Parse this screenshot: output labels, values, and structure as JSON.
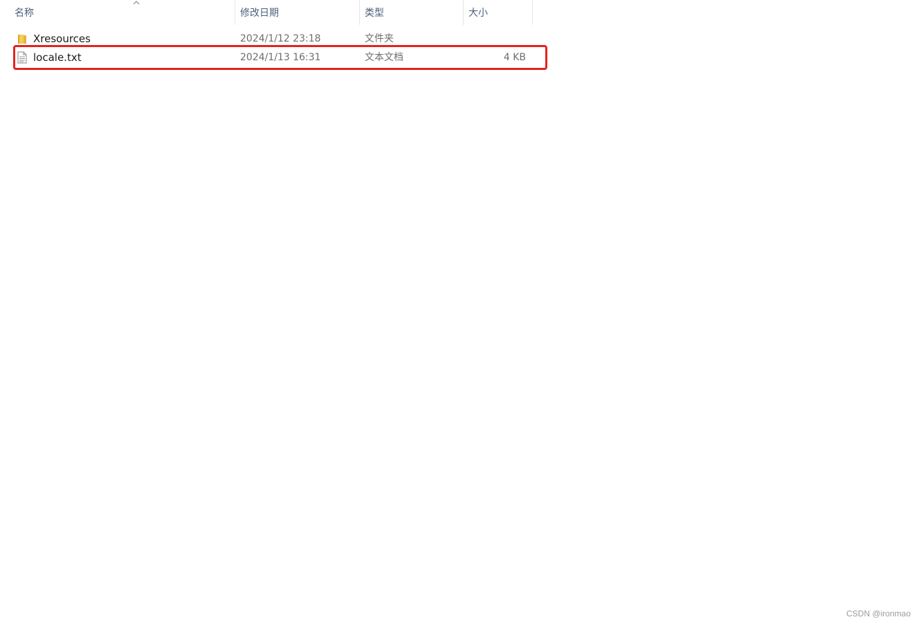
{
  "columns": {
    "name": "名称",
    "date": "修改日期",
    "type": "类型",
    "size": "大小"
  },
  "sort_indicator": "chevron-up-icon",
  "files": [
    {
      "icon": "folder-icon",
      "name": "Xresources",
      "date": "2024/1/12 23:18",
      "type": "文件夹",
      "size": ""
    },
    {
      "icon": "text-file-icon",
      "name": "locale.txt",
      "date": "2024/1/13 16:31",
      "type": "文本文档",
      "size": "4 KB",
      "highlighted": true
    }
  ],
  "highlight_color": "#e5231c",
  "watermark": "CSDN @ironmao"
}
